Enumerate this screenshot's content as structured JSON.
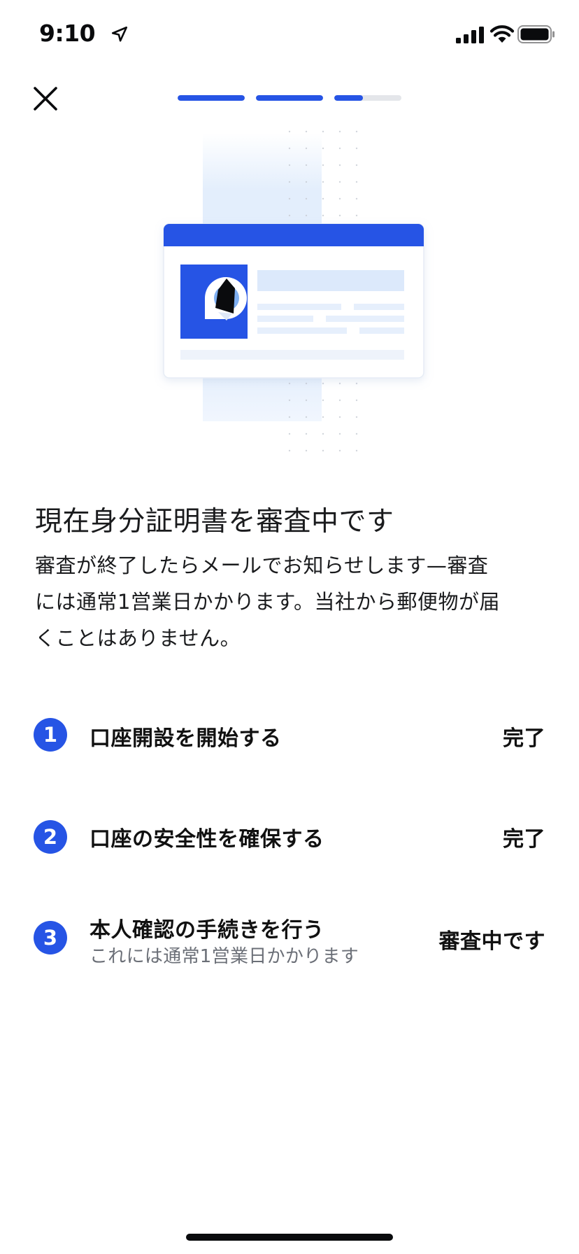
{
  "status_bar": {
    "time": "9:10",
    "icons": [
      "location-arrow-icon",
      "cellular-signal-icon",
      "wifi-icon",
      "battery-icon"
    ]
  },
  "nav": {
    "close_icon": "close-icon",
    "progress_segments": [
      1.0,
      1.0,
      0.43
    ]
  },
  "illustration": {
    "icon": "id-card-illustration"
  },
  "content": {
    "title": "現在身分証明書を審査中です",
    "description_lines": [
      "審査が終了したらメールでお知らせします—審査",
      "には通常1営業日かかります。当社から郵便物が届",
      "くことはありません。"
    ]
  },
  "steps": [
    {
      "number": "1",
      "title": "口座開設を開始する",
      "subtitle": "",
      "status": "完了"
    },
    {
      "number": "2",
      "title": "口座の安全性を確保する",
      "subtitle": "",
      "status": "完了"
    },
    {
      "number": "3",
      "title": "本人確認の手続きを行う",
      "subtitle": "これには通常1営業日かかります",
      "status": "審査中です"
    }
  ],
  "colors": {
    "accent": "#2654e5",
    "track": "#e4e6ea",
    "card_light": "#dce9fb",
    "text_primary": "#111111",
    "text_secondary": "#6b6f77"
  }
}
